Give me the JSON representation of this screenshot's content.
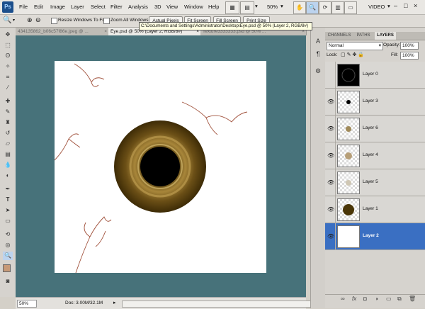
{
  "app": {
    "logo": "Ps"
  },
  "menu": [
    "File",
    "Edit",
    "Image",
    "Layer",
    "Select",
    "Filter",
    "Analysis",
    "3D",
    "View",
    "Window",
    "Help"
  ],
  "topbar": {
    "zoom_value": "50%",
    "workspace": "VIDEO"
  },
  "options": {
    "resize_label": "Resize Windows To Fit",
    "zoom_all_label": "Zoom All Windows",
    "actual_pixels": "Actual Pixels",
    "fit_screen": "Fit Screen",
    "fill_screen": "Fill Screen",
    "print_size": "Print Size"
  },
  "tabs": [
    {
      "label": "434135862_b06c57f86e.jpeg @ ...",
      "close": "×"
    },
    {
      "label": "Eye.psd @ 50% (Layer 2, RGB/8#)",
      "close": "×"
    },
    {
      "label": "Texture3333333.psd @ 50% ...",
      "close": "×"
    }
  ],
  "tooltip": "C:\\Documents and Settings\\Administrator\\Desktop\\Eye.psd @ 50% (Layer 2, RGB/8#)",
  "status": {
    "zoom": "50%",
    "doc": "Doc: 3.00M/32.1M"
  },
  "panel": {
    "tabs": [
      "CHANNELS",
      "PATHS",
      "LAYERS"
    ],
    "blend_mode": "Normal",
    "opacity_label": "Opacity:",
    "opacity_value": "100%",
    "lock_label": "Lock:",
    "fill_label": "Fill:",
    "fill_value": "100%",
    "layers": [
      {
        "name": "Layer 0",
        "visible": false,
        "selected": false
      },
      {
        "name": "Layer 3",
        "visible": true,
        "selected": false
      },
      {
        "name": "Layer 6",
        "visible": true,
        "selected": false
      },
      {
        "name": "Layer 4",
        "visible": true,
        "selected": false
      },
      {
        "name": "Layer 5",
        "visible": true,
        "selected": false
      },
      {
        "name": "Layer 1",
        "visible": true,
        "selected": false
      },
      {
        "name": "Layer 2",
        "visible": true,
        "selected": true
      }
    ],
    "footer_icons": [
      "link-icon",
      "fx-icon",
      "mask-icon",
      "adjustment-icon",
      "folder-icon",
      "new-layer-icon",
      "trash-icon"
    ]
  },
  "colors": {
    "canvas_bg": "#47727a",
    "selection": "#3a6fc2",
    "iris": "#6b4f16"
  }
}
